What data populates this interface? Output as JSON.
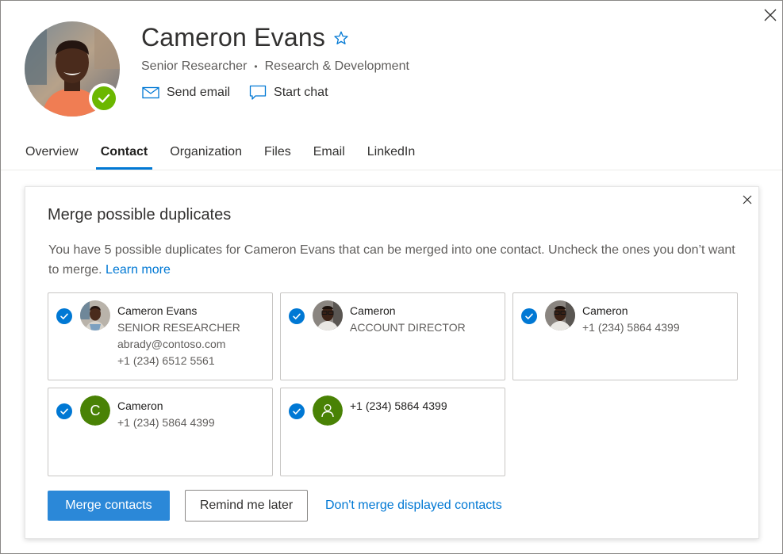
{
  "profile": {
    "name": "Cameron Evans",
    "title": "Senior Researcher",
    "separator": "•",
    "department": "Research & Development",
    "presence": "available"
  },
  "actions": [
    {
      "label": "Send email",
      "icon": "mail-icon"
    },
    {
      "label": "Start chat",
      "icon": "chat-icon"
    }
  ],
  "tabs": [
    {
      "label": "Overview",
      "active": false
    },
    {
      "label": "Contact",
      "active": true
    },
    {
      "label": "Organization",
      "active": false
    },
    {
      "label": "Files",
      "active": false
    },
    {
      "label": "Email",
      "active": false
    },
    {
      "label": "LinkedIn",
      "active": false
    }
  ],
  "merge": {
    "title": "Merge possible duplicates",
    "description": "You have 5 possible duplicates for Cameron Evans that can be merged into one contact. Uncheck the ones you don’t want to merge.",
    "learn_more": "Learn more",
    "cards": [
      {
        "checked": true,
        "avatar": "photo",
        "lines": [
          "Cameron Evans",
          "SENIOR RESEARCHER",
          "abrady@contoso.com",
          "+1 (234) 6512 5561"
        ]
      },
      {
        "checked": true,
        "avatar": "photo",
        "lines": [
          "Cameron",
          "ACCOUNT DIRECTOR"
        ]
      },
      {
        "checked": true,
        "avatar": "photo",
        "lines": [
          "Cameron",
          "+1 (234) 5864 4399"
        ]
      },
      {
        "checked": true,
        "avatar": "initial",
        "initial": "C",
        "lines": [
          "Cameron",
          "+1 (234) 5864 4399"
        ]
      },
      {
        "checked": true,
        "avatar": "person-icon",
        "lines": [
          "+1 (234) 5864 4399"
        ]
      }
    ],
    "merge_button": "Merge contacts",
    "remind_button": "Remind me later",
    "dont_merge_link": "Don't merge displayed contacts"
  },
  "colors": {
    "accent": "#0078d4",
    "primary_button": "#2b88d8",
    "presence_available": "#6bb700",
    "avatar_green": "#498205"
  }
}
